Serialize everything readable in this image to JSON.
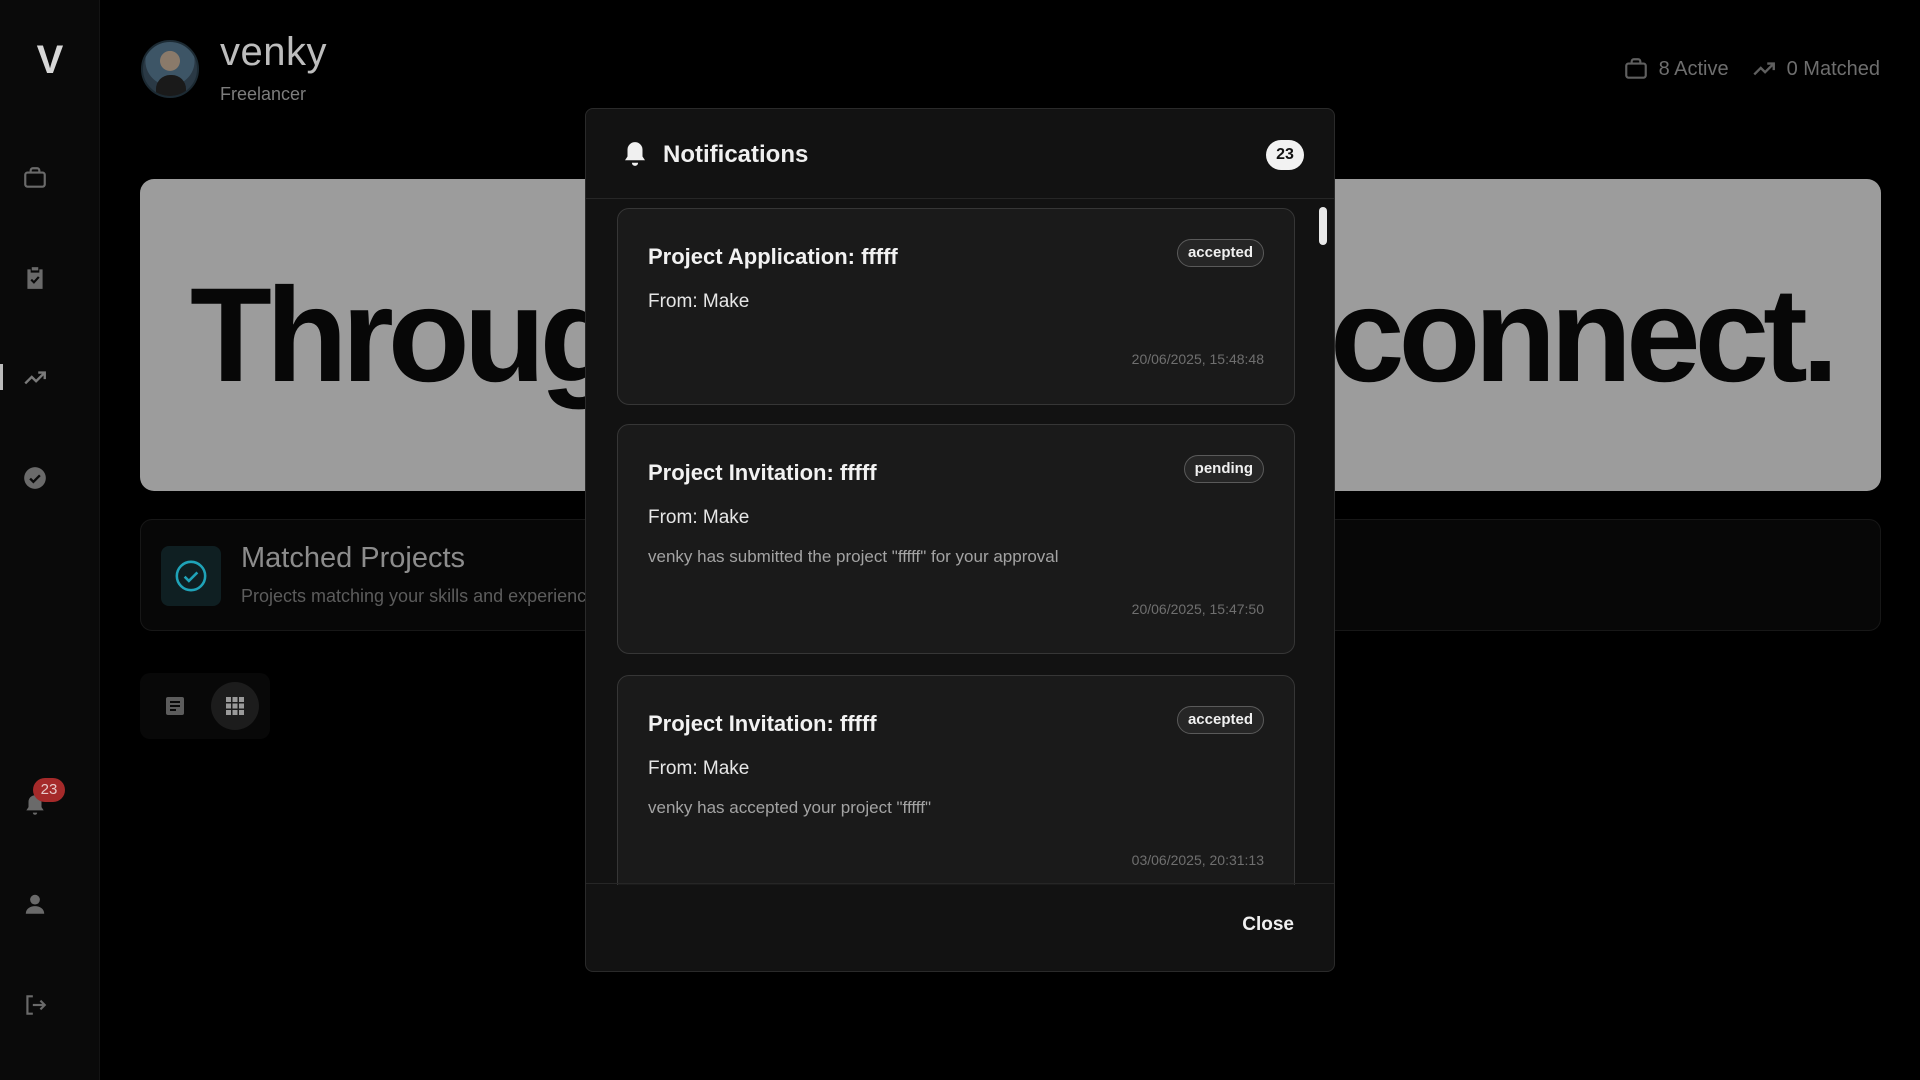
{
  "sidebar": {
    "logo": "V",
    "notification_count": "23",
    "items": [
      {
        "icon": "briefcase-icon"
      },
      {
        "icon": "clipboard-check-icon"
      },
      {
        "icon": "trending-up-icon"
      },
      {
        "icon": "check-circle-icon"
      },
      {
        "icon": "bell-icon"
      },
      {
        "icon": "user-icon"
      },
      {
        "icon": "logout-icon"
      }
    ]
  },
  "header": {
    "user_name": "venky",
    "user_role": "Freelancer",
    "stats": {
      "active_label": "8 Active",
      "matched_label": "0 Matched"
    }
  },
  "hero": {
    "text_left": "Throug",
    "text_right": "connect."
  },
  "matched_projects": {
    "title": "Matched Projects",
    "subtitle": "Projects matching your skills and experience"
  },
  "modal": {
    "title": "Notifications",
    "count": "23",
    "close_label": "Close",
    "notifications": [
      {
        "title": "Project Application: fffff",
        "status": "accepted",
        "from": "From: Make",
        "message": "",
        "timestamp": "20/06/2025, 15:48:48"
      },
      {
        "title": "Project Invitation: fffff",
        "status": "pending",
        "from": "From: Make",
        "message": "venky has submitted the project \"fffff\" for your approval",
        "timestamp": "20/06/2025, 15:47:50"
      },
      {
        "title": "Project Invitation: fffff",
        "status": "accepted",
        "from": "From: Make",
        "message": "venky has accepted your project \"fffff\"",
        "timestamp": "03/06/2025, 20:31:13"
      }
    ]
  },
  "colors": {
    "background": "#000000",
    "modal_bg": "#121212",
    "card_bg": "#1a1a1a",
    "badge_red": "#a52a2a",
    "accent_teal": "#1fa3b8"
  }
}
